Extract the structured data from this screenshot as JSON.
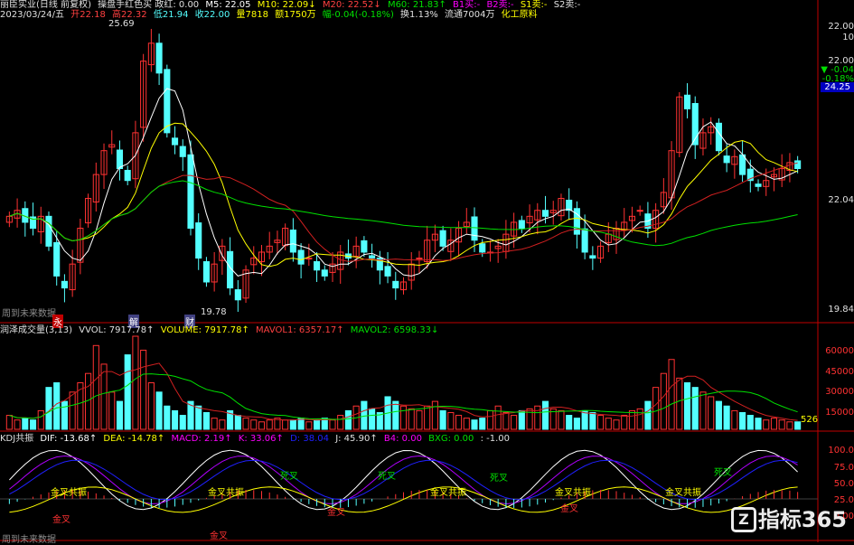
{
  "colors": {
    "up": "#ff3232",
    "down": "#54ffff",
    "white": "#ffffff",
    "yellow": "#ffff00",
    "magenta": "#ff00ff",
    "green": "#00e000",
    "red": "#d02020",
    "axis": "#c00000",
    "blue": "#2020ff",
    "purple": "#b000ff"
  },
  "header": {
    "stock": "丽臣实业(日线 前复权)",
    "indicator": "操盘手红色买 政红: 0.00",
    "m5": "M5: 22.05",
    "m10": "M10: 22.09↓",
    "m20": "M20: 22.52↓",
    "m60": "M60: 21.83↑",
    "b1": "B1买:-",
    "b2": "B2卖:-",
    "s1": "S1卖:-",
    "s2": "S2卖:-",
    "date": "2023/03/24/五",
    "open": "开22.18",
    "high": "高22.32",
    "low": "低21.94",
    "close": "收22.00",
    "vol": "量7818",
    "amount": "额1750万",
    "change": "幅-0.04(-0.18%)",
    "turnover": "换1.13%",
    "float": "流通7004万",
    "sector": "化工原料"
  },
  "price_axis": {
    "right_top": "22.00",
    "right_top2": "10",
    "ref": "22.00",
    "chg": "▼ -0.04",
    "pct": "-0.18%",
    "cur": "24.25",
    "mid": "22.04",
    "low": "19.84"
  },
  "annotations": {
    "high": "25.69",
    "low": "19.78"
  },
  "future_label_1": "周到未来数据",
  "future_label_2": "周到未来数据",
  "event_tags": [
    "永",
    "解",
    "财"
  ],
  "vol_panel": {
    "title": "润泽成交量(3,13)",
    "vvol": "VVOL: 7917.78↑",
    "volume": "VOLUME: 7917.78↑",
    "mavol1": "MAVOL1: 6357.17↑",
    "mavol2": "MAVOL2: 6598.33↓",
    "ticks": [
      "60000",
      "45000",
      "30000",
      "15000"
    ],
    "last": "526"
  },
  "kdj_panel": {
    "title": "KDJ共振",
    "dif": "DIF: -13.68↑",
    "dea": "DEA: -14.78↑",
    "macd": "MACD: 2.19↑",
    "k": "K: 33.06↑",
    "d": "D: 38.04",
    "j": "J: 45.90↑",
    "b4": "B4: 0.00",
    "bxg": "BXG: 0.00",
    "last": ": -1.00",
    "ticks": [
      "100.0",
      "75.0",
      "50.0",
      "25.0",
      "0.00"
    ]
  },
  "signals": {
    "jc": "金叉",
    "sc": "死叉",
    "gz": "金叉共振"
  },
  "watermark": "指标365",
  "chart_data": {
    "type": "candlestick",
    "close": [
      21.2,
      21.3,
      21.1,
      21.0,
      21.2,
      20.7,
      20.2,
      20.0,
      20.4,
      21.0,
      21.5,
      21.9,
      22.3,
      22.4,
      22.0,
      21.8,
      22.6,
      23.8,
      24.1,
      23.6,
      22.6,
      22.4,
      22.2,
      21.0,
      20.5,
      20.1,
      20.4,
      20.7,
      20.0,
      19.8,
      20.3,
      20.5,
      20.6,
      20.7,
      20.8,
      21.0,
      20.6,
      20.4,
      20.5,
      20.3,
      20.2,
      20.4,
      20.6,
      20.5,
      20.7,
      20.6,
      20.5,
      20.3,
      20.2,
      20.0,
      20.1,
      20.4,
      20.5,
      20.8,
      20.9,
      20.7,
      20.8,
      21.0,
      21.1,
      20.8,
      20.6,
      20.6,
      20.7,
      20.9,
      21.1,
      21.0,
      21.2,
      21.3,
      21.2,
      21.3,
      21.5,
      21.3,
      20.9,
      20.6,
      20.5,
      20.7,
      20.9,
      21.0,
      21.1,
      21.2,
      21.3,
      21.0,
      21.3,
      21.6,
      22.3,
      23.2,
      23.0,
      22.4,
      22.6,
      22.7,
      22.3,
      22.1,
      22.2,
      21.9,
      21.8,
      21.7,
      21.8,
      21.9,
      22.0,
      22.1,
      22.0
    ],
    "open_delta_note": "",
    "volume_rel": [
      0.15,
      0.1,
      0.12,
      0.1,
      0.2,
      0.45,
      0.5,
      0.3,
      0.4,
      0.5,
      0.6,
      0.9,
      0.7,
      0.4,
      0.3,
      0.8,
      1.0,
      0.85,
      0.5,
      0.4,
      0.25,
      0.2,
      0.15,
      0.3,
      0.25,
      0.18,
      0.12,
      0.1,
      0.2,
      0.15,
      0.12,
      0.1,
      0.08,
      0.1,
      0.12,
      0.1,
      0.1,
      0.12,
      0.08,
      0.1,
      0.12,
      0.1,
      0.15,
      0.2,
      0.25,
      0.3,
      0.22,
      0.18,
      0.35,
      0.3,
      0.25,
      0.22,
      0.2,
      0.25,
      0.3,
      0.2,
      0.18,
      0.15,
      0.12,
      0.1,
      0.12,
      0.2,
      0.25,
      0.18,
      0.15,
      0.2,
      0.22,
      0.25,
      0.3,
      0.22,
      0.2,
      0.15,
      0.12,
      0.2,
      0.18,
      0.15,
      0.12,
      0.1,
      0.15,
      0.2,
      0.22,
      0.3,
      0.45,
      0.6,
      0.75,
      0.55,
      0.5,
      0.45,
      0.4,
      0.35,
      0.3,
      0.25,
      0.2,
      0.18,
      0.15,
      0.12,
      0.1,
      0.12,
      0.1,
      0.08,
      0.08
    ]
  }
}
